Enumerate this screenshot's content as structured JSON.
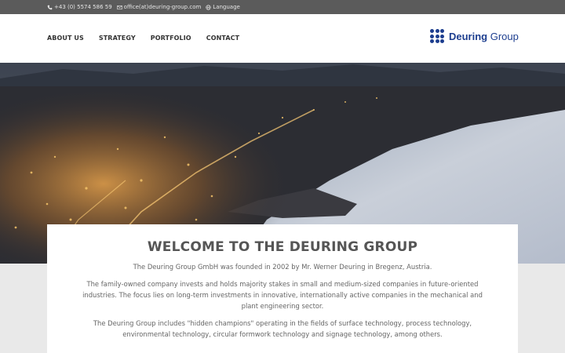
{
  "topbar": {
    "phone": "+43 (0) 5574 586 59",
    "email": "office(at)deuring-group.com",
    "language": "Language",
    "bg_color": "#5b5b5b"
  },
  "nav": {
    "items": [
      "ABOUT US",
      "STRATEGY",
      "PORTFOLIO",
      "CONTACT"
    ]
  },
  "logo": {
    "name_bold": "Deuring",
    "name_light": " Group",
    "brand_color": "#1d3e8f"
  },
  "hero": {
    "icon": "city-night-lake-photo"
  },
  "welcome": {
    "title": "WELCOME TO THE DEURING GROUP",
    "paragraphs": [
      "The Deuring Group GmbH was founded in 2002 by Mr. Werner Deuring in Bregenz, Austria.",
      "The family-owned company invests and holds majority stakes in small and medium-sized companies in future-oriented industries. The focus lies on long-term investments in innovative, internationally active companies in the mechanical and plant engineering sector.",
      "The Deuring Group includes \"hidden champions\" operating in the fields of surface technology, process technology, environmental technology, circular formwork technology and signage technology, among others."
    ]
  }
}
